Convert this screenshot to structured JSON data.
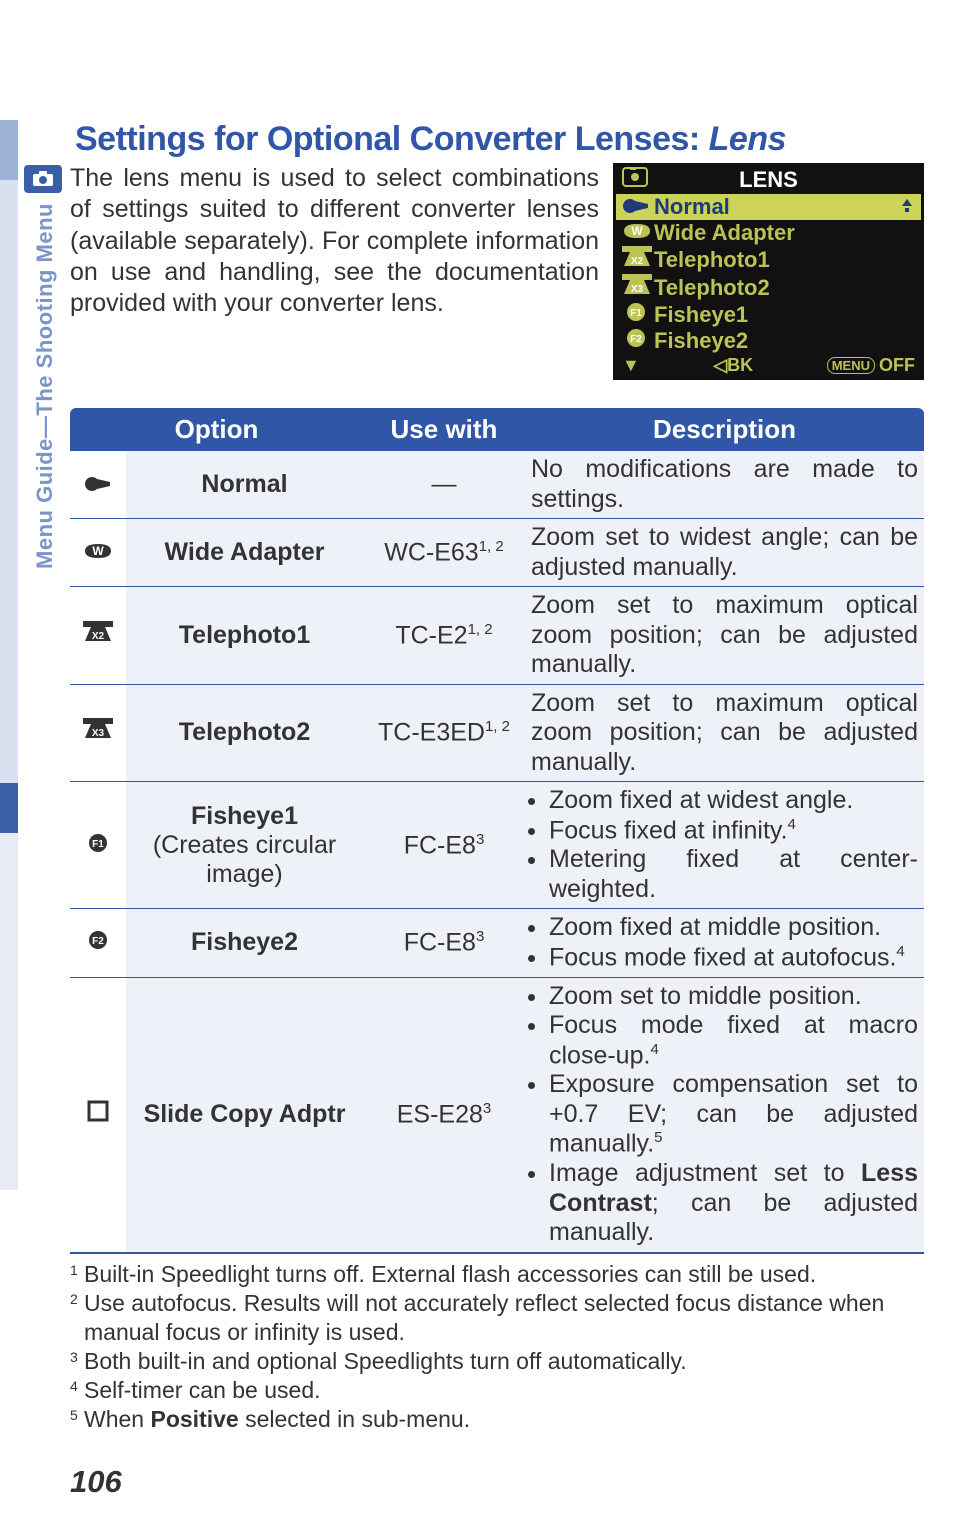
{
  "heading_a": "Settings for Optional Converter Lenses: ",
  "heading_b": "Lens",
  "sidebar_label": "Menu Guide—The Shooting Menu",
  "intro": "The lens menu is used to select combinations of settings suited to different converter lenses (available separately).  For complete information on use and handling, see the documentation provided with your converter lens.",
  "lcd": {
    "title": "LENS",
    "items": [
      {
        "label": "Normal",
        "active": true,
        "icon": "lens"
      },
      {
        "label": "Wide Adapter",
        "active": false,
        "icon": "W"
      },
      {
        "label": "Telephoto1",
        "active": false,
        "icon": "X2"
      },
      {
        "label": "Telephoto2",
        "active": false,
        "icon": "X3"
      },
      {
        "label": "Fisheye1",
        "active": false,
        "icon": "F1"
      },
      {
        "label": "Fisheye2",
        "active": false,
        "icon": "F2"
      }
    ],
    "footer_left": "◁BK",
    "footer_right": "OFF",
    "footer_menu": "MENU"
  },
  "table": {
    "headers": {
      "option": "Option",
      "use": "Use with",
      "desc": "Description"
    },
    "rows": [
      {
        "icon": "lens",
        "name": "Normal",
        "sub": "",
        "use": "—",
        "use_sup": "",
        "desc_plain": "No modifications are made to settings."
      },
      {
        "icon": "W",
        "name": "Wide Adapter",
        "sub": "",
        "use": "WC-E63",
        "use_sup": "1, 2",
        "desc_plain": "Zoom set to widest angle; can be adjusted manually."
      },
      {
        "icon": "X2",
        "name": "Telephoto1",
        "sub": "",
        "use": "TC-E2",
        "use_sup": "1, 2",
        "desc_plain": "Zoom set to maximum optical zoom position; can be adjusted manually."
      },
      {
        "icon": "X3",
        "name": "Telephoto2",
        "sub": "",
        "use": "TC-E3ED",
        "use_sup": "1, 2",
        "desc_plain": "Zoom set to maximum optical zoom position; can be adjusted manually."
      },
      {
        "icon": "F1",
        "name": "Fisheye1",
        "sub": "(Creates circular image)",
        "use": "FC-E8",
        "use_sup": "3",
        "desc_list": [
          {
            "t": "Zoom fixed at widest angle.",
            "sup": ""
          },
          {
            "t": "Focus fixed at infinity.",
            "sup": "4"
          },
          {
            "t": "Metering fixed at center-weighted.",
            "sup": ""
          }
        ]
      },
      {
        "icon": "F2",
        "name": "Fisheye2",
        "sub": "",
        "use": "FC-E8",
        "use_sup": "3",
        "desc_list": [
          {
            "t": "Zoom fixed at middle position.",
            "sup": ""
          },
          {
            "t": "Focus mode fixed at autofocus.",
            "sup": "4"
          }
        ]
      },
      {
        "icon": "SQ",
        "name": "Slide Copy Adptr",
        "sub": "",
        "use": "ES-E28",
        "use_sup": "3",
        "desc_list": [
          {
            "t": "Zoom set to middle position.",
            "sup": ""
          },
          {
            "t": "Focus mode fixed at macro close-up.",
            "sup": "4"
          },
          {
            "t": "Exposure compensation set to +0.7 EV; can be adjusted manually.",
            "sup": "5"
          },
          {
            "t_html": "Image adjustment set to <b>Less Contrast</b>; can be adjusted manually."
          }
        ]
      }
    ]
  },
  "footnotes": [
    {
      "n": "1",
      "t": "Built-in Speedlight turns off.  External flash accessories can still be used."
    },
    {
      "n": "2",
      "t": "Use autofocus.  Results will not accurately reflect selected focus distance when manual focus or infinity is used."
    },
    {
      "n": "3",
      "t": "Both built-in and optional Speedlights turn off automatically."
    },
    {
      "n": "4",
      "t": "Self-timer can be used."
    },
    {
      "n": "5",
      "t_html": "When <b>Positive</b> selected in sub-menu."
    }
  ],
  "page_number": "106"
}
